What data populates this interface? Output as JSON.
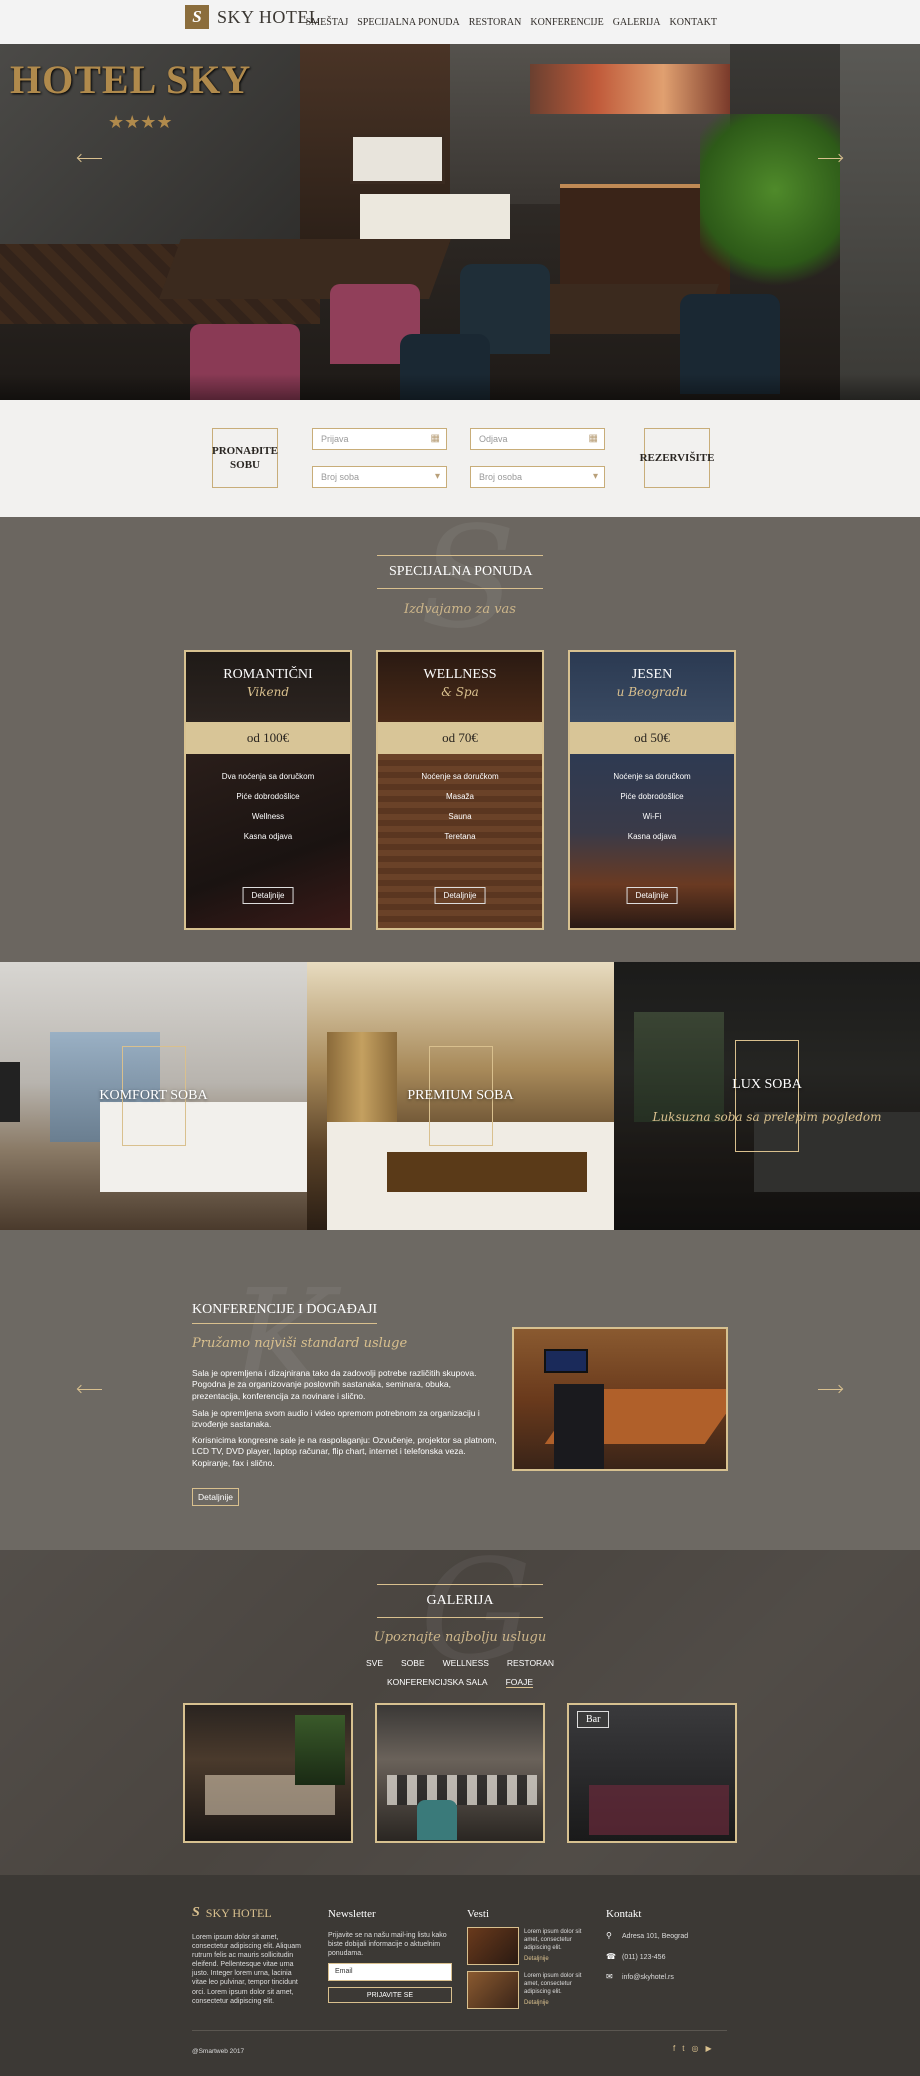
{
  "header": {
    "brand": "SKY HOTEL",
    "nav": [
      "SMEŠTAJ",
      "SPECIJALNA PONUDA",
      "RESTORAN",
      "KONFERENCIJE",
      "GALERIJA",
      "KONTAKT"
    ]
  },
  "hero": {
    "sign": "HOTEL SKY",
    "stars": "★★★★"
  },
  "booking": {
    "find_label": "PRONAĐITE SOBU",
    "arrival_placeholder": "Prijava",
    "departure_placeholder": "Odjava",
    "rooms_placeholder": "Broj soba",
    "persons_placeholder": "Broj osoba",
    "reserve_label": "REZERVIŠITE"
  },
  "special": {
    "title": "SPECIJALNA PONUDA",
    "subtitle": "Izdvajamo za vas",
    "cards": [
      {
        "title": "ROMANTIČNI",
        "sub": "Vikend",
        "price": "od 100€",
        "items": [
          "Dva noćenja sa doručkom",
          "Piće dobrodošlice",
          "Wellness",
          "Kasna odjava"
        ],
        "btn": "Detaljnije"
      },
      {
        "title": "WELLNESS",
        "sub": "& Spa",
        "price": "od 70€",
        "items": [
          "Noćenje sa doručkom",
          "Masaža",
          "Sauna",
          "Teretana"
        ],
        "btn": "Detaljnije"
      },
      {
        "title": "JESEN",
        "sub": "u Beogradu",
        "price": "od 50€",
        "items": [
          "Noćenje sa doručkom",
          "Piće dobrodošlice",
          "Wi-Fi",
          "Kasna odjava"
        ],
        "btn": "Detaljnije"
      }
    ]
  },
  "rooms": [
    {
      "name": "KOMFORT SOBA"
    },
    {
      "name": "PREMIUM SOBA"
    },
    {
      "name": "LUX SOBA",
      "desc": "Luksuzna soba sa prelepim pogledom"
    }
  ],
  "conference": {
    "title": "KONFERENCIJE I DOGAĐAJI",
    "subtitle": "Pružamo najviši standard usluge",
    "p1": "Sala je opremljena i dizajnirana tako da zadovolji potrebe različitih skupova. Pogodna je za organizovanje poslovnih sastanaka, seminara, obuka, prezentacija, konferencija za novinare i slično.",
    "p2": "Sala je opremljena svom audio i video opremom potrebnom za organizaciju i izvođenje sastanaka.",
    "p3": "Korisnicima kongresne sale je na raspolaganju: Ozvučenje, projektor sa platnom, LCD TV, DVD player, laptop računar, flip chart, internet i telefonska veza. Kopiranje, fax i slično.",
    "btn": "Detaljnije"
  },
  "gallery": {
    "title": "GALERIJA",
    "subtitle": "Upoznajte najbolju uslugu",
    "filters_row1": [
      "SVE",
      "SOBE",
      "WELLNESS",
      "RESTORAN"
    ],
    "filters_row2": [
      "KONFERENCIJSKA SALA",
      "FOAJE"
    ],
    "caption": "Bar"
  },
  "footer": {
    "brand": "SKY HOTEL",
    "about": "Lorem ipsum dolor sit amet, consectetur adipiscing elit. Aliquam rutrum felis ac mauris sollicitudin eleifend. Pellentesque vitae urna justo. Integer lorem urna, lacinia vitae leo pulvinar, tempor tincidunt orci. Lorem ipsum dolor sit amet, consectetur adipiscing elit.",
    "newsletter_title": "Newsletter",
    "newsletter_text": "Prijavite se na našu mail-ing listu kako biste dobijali informacije o aktuelnim ponudama.",
    "email_placeholder": "Email",
    "subscribe_label": "PRIJAVITE SE",
    "news_title": "Vesti",
    "news": [
      {
        "text": "Lorem ipsum dolor sit amet, consectetur adipiscing elit.",
        "link": "Detaljnije"
      },
      {
        "text": "Lorem ipsum dolor sit amet, consectetur adipiscing elit.",
        "link": "Detaljnije"
      }
    ],
    "contact_title": "Kontakt",
    "address": "Adresa 101, Beograd",
    "phone": "(011) 123-456",
    "email": "info@skyhotel.rs",
    "copyright": "@Smartweb 2017"
  }
}
